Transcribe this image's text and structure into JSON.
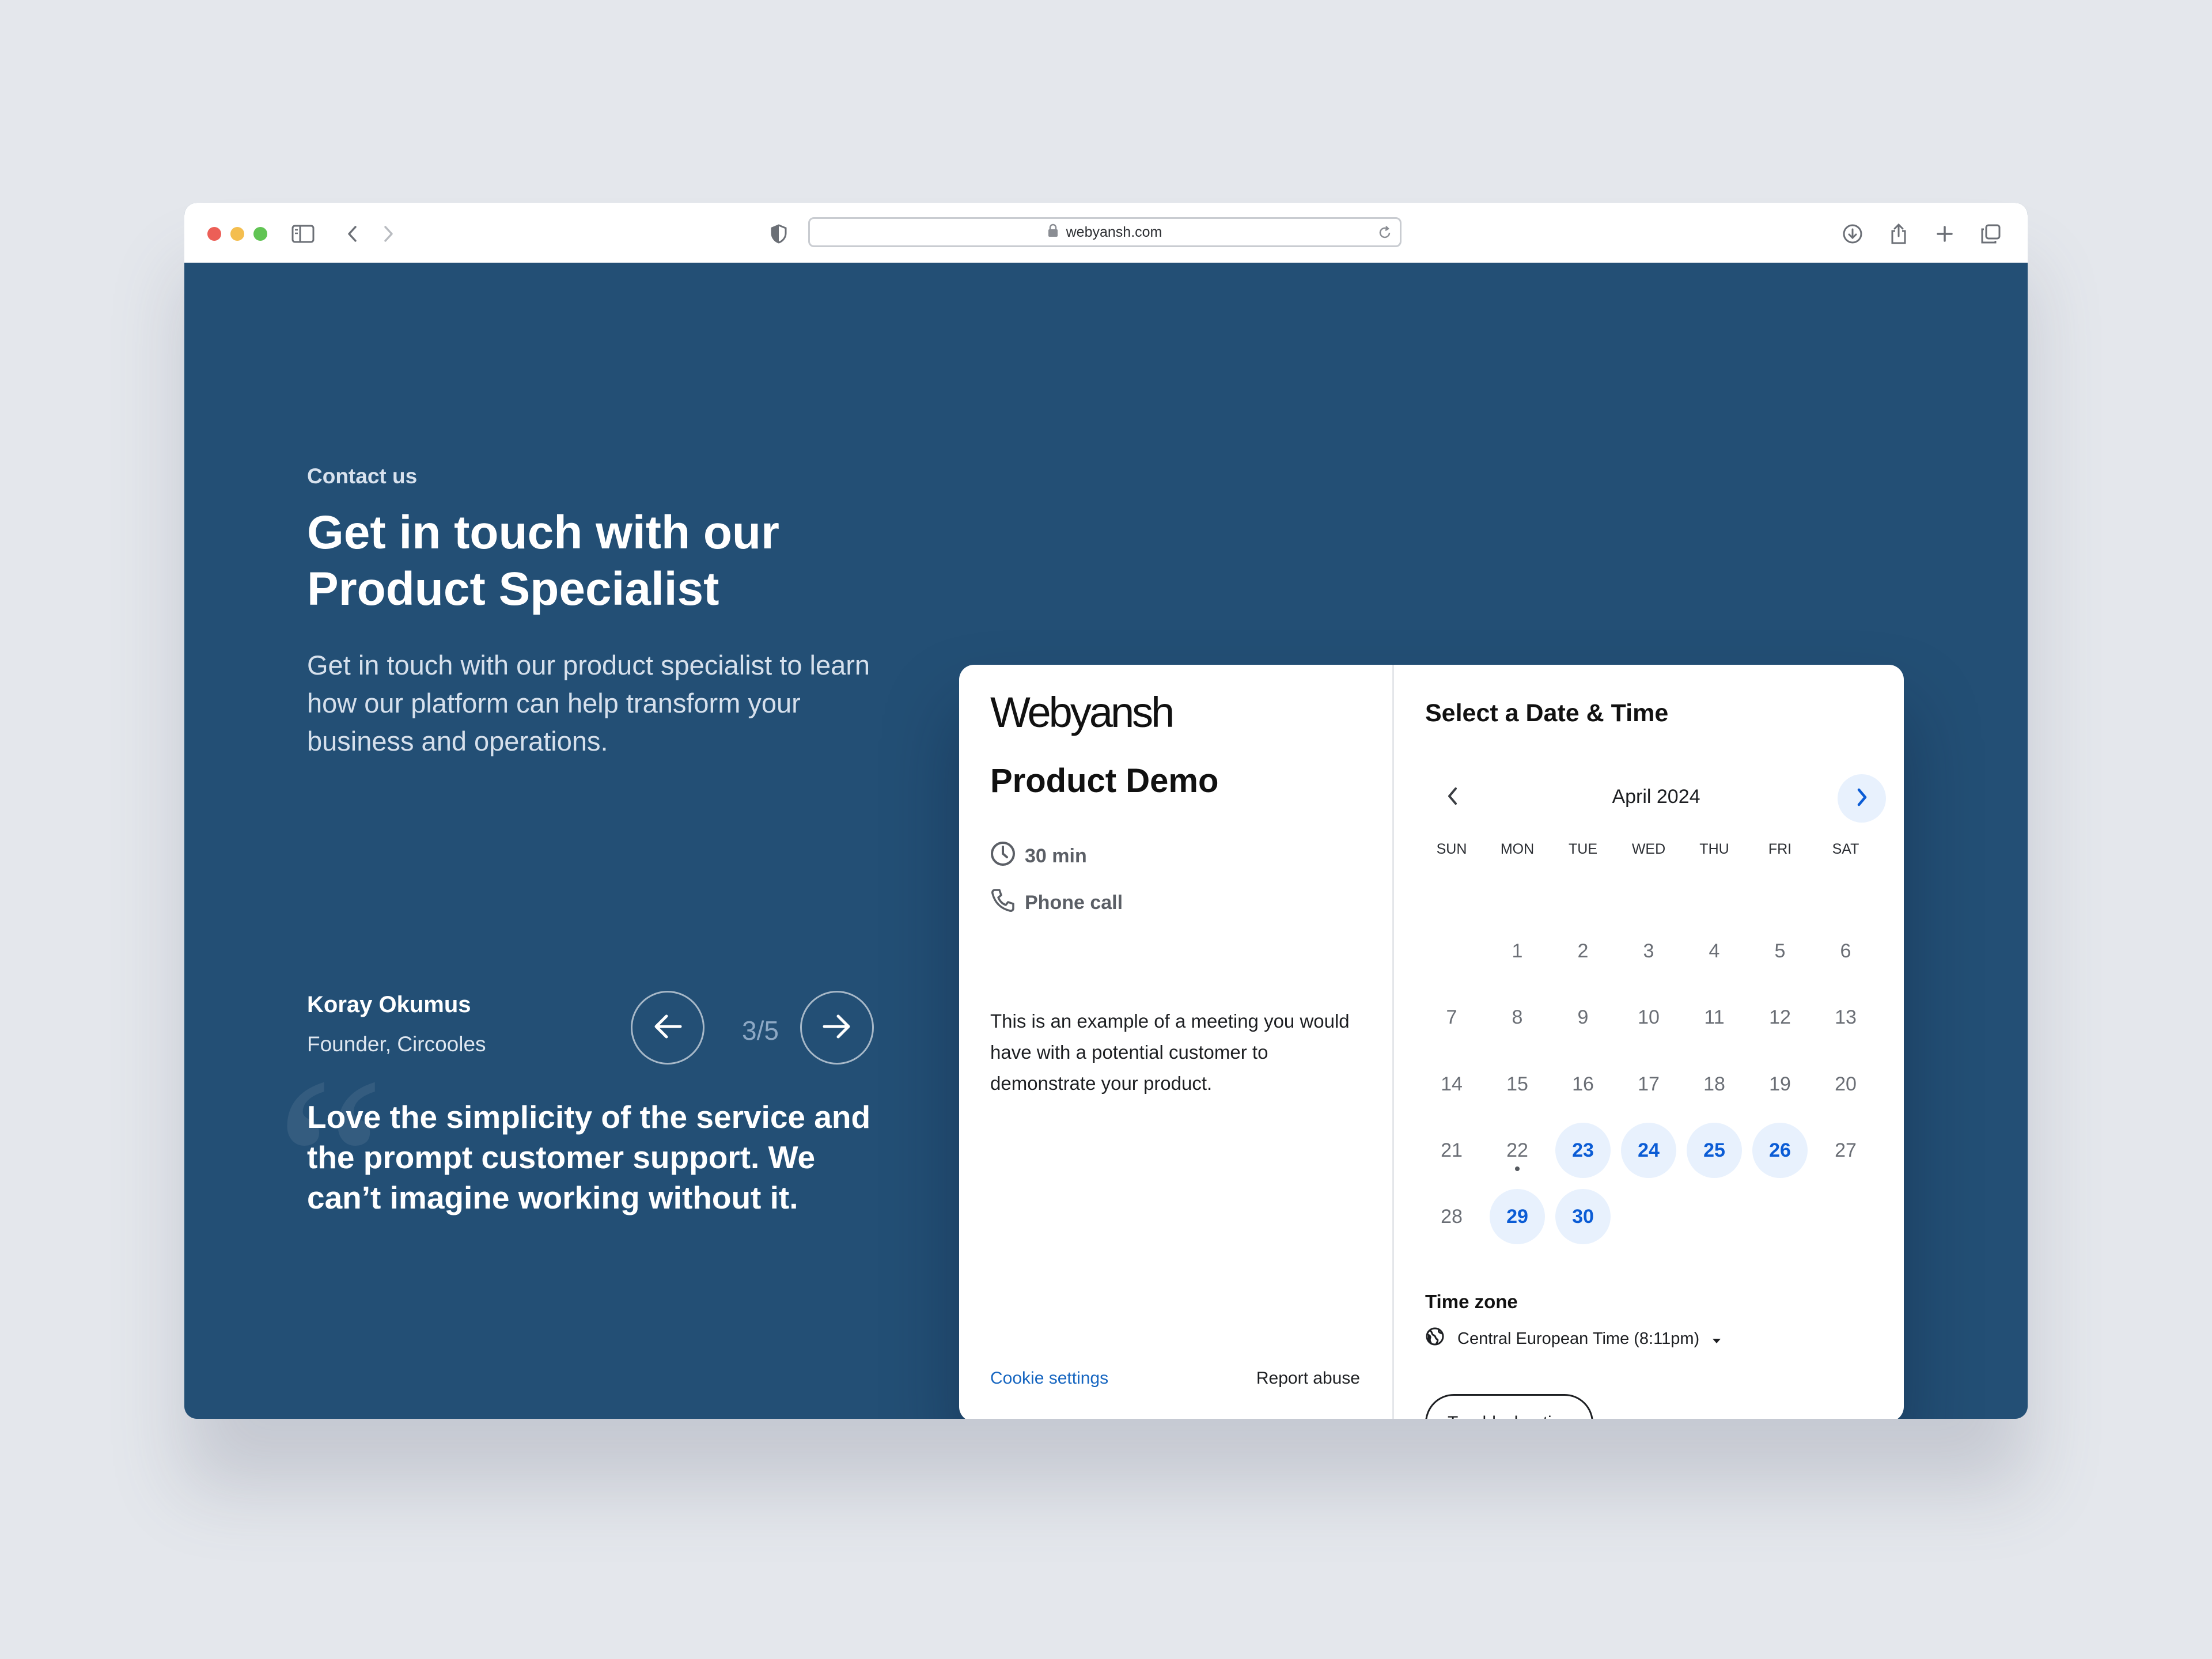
{
  "browser": {
    "url": "webyansh.com",
    "colors": {
      "close": "#ec5f57",
      "minimize": "#f4be4f",
      "maximize": "#61c454"
    },
    "icons": [
      "sidebar-icon",
      "back-icon",
      "forward-icon",
      "shield-icon",
      "lock-icon",
      "reload-icon",
      "download-icon",
      "share-icon",
      "new-tab-icon",
      "tabs-overview-icon"
    ]
  },
  "hero": {
    "eyebrow": "Contact us",
    "heading": "Get in touch with our Product Specialist",
    "lead": "Get in touch with our product specialist to learn how our platform can help transform your business and operations."
  },
  "testimonial": {
    "name": "Koray Okumus",
    "role": "Founder, Circooles",
    "counter": "3/5",
    "quote_mark": "“",
    "quote": "Love the simplicity of the service and the prompt customer support. We can’t imagine working without it."
  },
  "booking": {
    "logo": "Webyansh",
    "event_title": "Product Demo",
    "duration": "30 min",
    "location": "Phone call",
    "description": "This is an example of a meeting you would have with a potential customer to demonstrate your product.",
    "cookie_settings": "Cookie settings",
    "report_abuse": "Report abuse"
  },
  "calendar": {
    "title": "Select a Date & Time",
    "month": "April 2024",
    "weekdays": [
      "SUN",
      "MON",
      "TUE",
      "WED",
      "THU",
      "FRI",
      "SAT"
    ],
    "first_weekday_index": 1,
    "days_in_month": 30,
    "available_days": [
      23,
      24,
      25,
      26,
      29,
      30
    ],
    "today": 22,
    "accent_color": "#0b5cd5",
    "available_bg": "#e8f1fd"
  },
  "timezone": {
    "label": "Time zone",
    "value": "Central European Time (8:11pm)"
  },
  "troubleshooting": "Troubleshooting"
}
